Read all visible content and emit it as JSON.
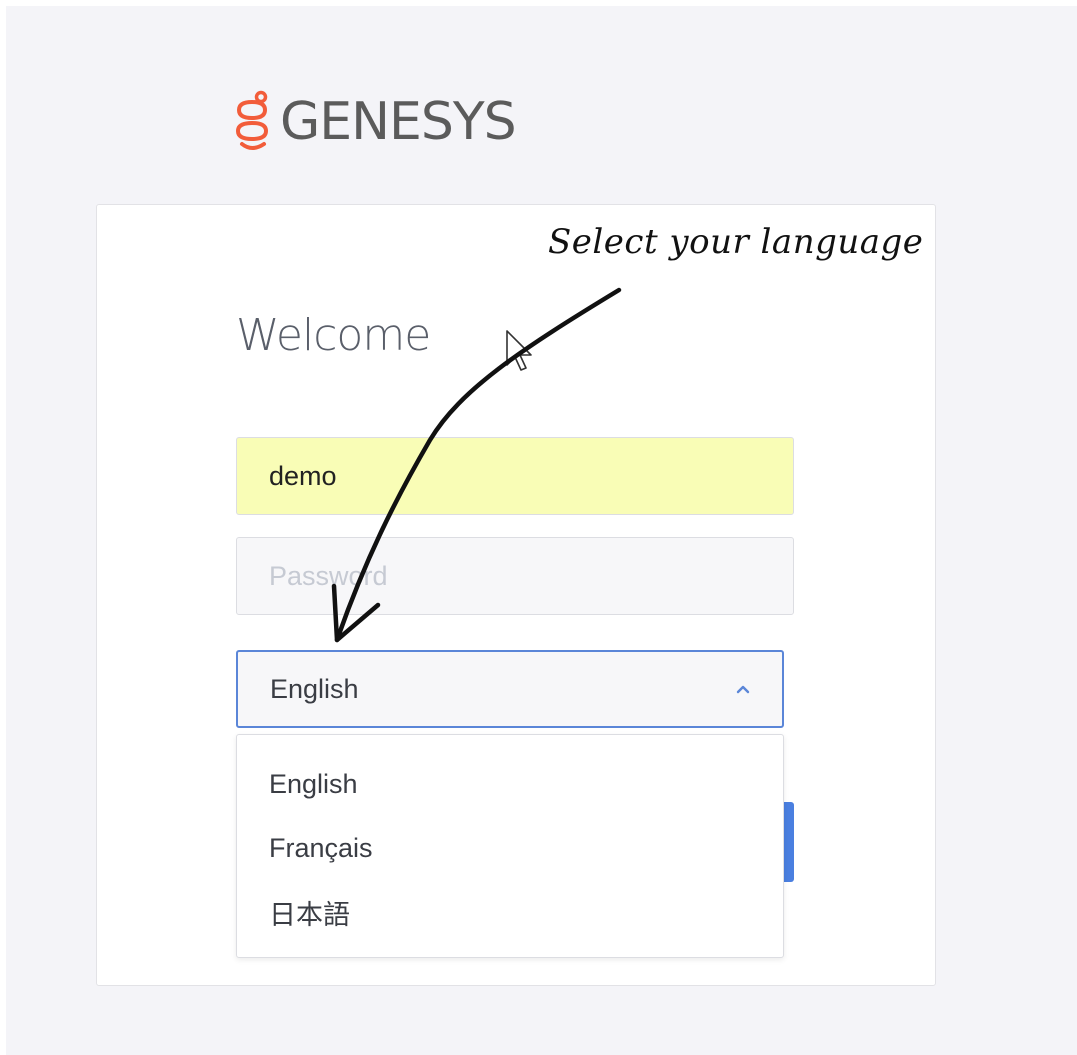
{
  "logo": {
    "text": "GENESYS",
    "brand_color": "#f25c3a",
    "text_color": "#5b5b5b"
  },
  "login": {
    "heading": "Welcome",
    "username": {
      "value": "demo"
    },
    "password": {
      "value": "",
      "placeholder": "Password"
    },
    "language_select": {
      "selected": "English",
      "expanded": true,
      "options": [
        "English",
        "Français",
        "日本語"
      ],
      "accent_color": "#5b86d8"
    },
    "submit_button": {
      "label": "",
      "color": "#4a7fe0"
    }
  },
  "annotation": {
    "text": "Select your language",
    "icon": "curved-arrow-icon"
  },
  "cursor": {
    "icon": "mouse-pointer-icon"
  }
}
